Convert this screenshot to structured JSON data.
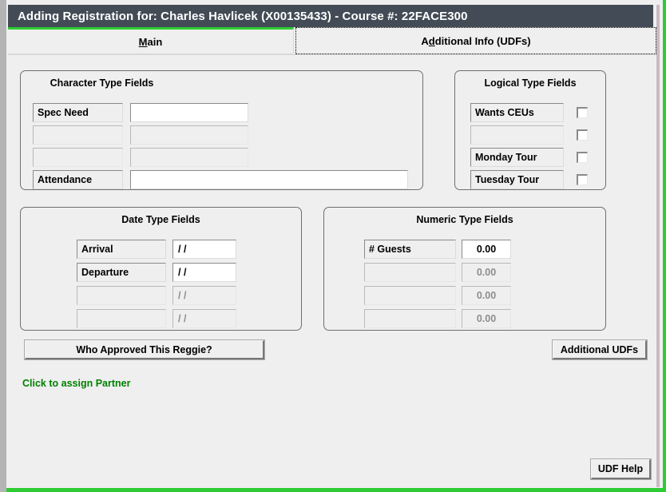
{
  "window": {
    "title": "Adding Registration for: Charles Havlicek (X00135433) - Course #: 22FACE300",
    "accent_green": "#2ecc33",
    "titlebar_color": "#434c56"
  },
  "tabs": [
    {
      "label_pre": "",
      "accel": "M",
      "label_post": "ain",
      "name": "tab-main",
      "selected": false
    },
    {
      "label_pre": "A",
      "accel": "d",
      "label_post": "ditional Info (UDFs)",
      "name": "tab-additional-info-udfs",
      "selected": true
    }
  ],
  "groups": {
    "character": {
      "title": "Character Type Fields",
      "rows": [
        {
          "label": "Spec Need",
          "value": "",
          "enabled": true
        },
        {
          "label": "",
          "value": "",
          "enabled": false
        },
        {
          "label": "",
          "value": "",
          "enabled": false
        },
        {
          "label": "Attendance",
          "value": "",
          "enabled": true
        }
      ]
    },
    "logical": {
      "title": "Logical Type Fields",
      "rows": [
        {
          "label": "Wants CEUs",
          "checked": false,
          "enabled": true
        },
        {
          "label": "",
          "checked": false,
          "enabled": false
        },
        {
          "label": "Monday Tour",
          "checked": false,
          "enabled": true
        },
        {
          "label": "Tuesday Tour",
          "checked": false,
          "enabled": true
        }
      ]
    },
    "date": {
      "title": "Date Type Fields",
      "rows": [
        {
          "label": "Arrival",
          "value": "/  /",
          "enabled": true
        },
        {
          "label": "Departure",
          "value": "/  /",
          "enabled": true
        },
        {
          "label": "",
          "value": "/  /",
          "enabled": false
        },
        {
          "label": "",
          "value": "/  /",
          "enabled": false
        }
      ]
    },
    "numeric": {
      "title": "Numeric Type Fields",
      "rows": [
        {
          "label": "# Guests",
          "value": "0.00",
          "enabled": true
        },
        {
          "label": "",
          "value": "0.00",
          "enabled": false
        },
        {
          "label": "",
          "value": "0.00",
          "enabled": false
        },
        {
          "label": "",
          "value": "0.00",
          "enabled": false
        }
      ]
    }
  },
  "buttons": {
    "who_approved": "Who Approved This Reggie?",
    "additional_udfs": "Additional UDFs",
    "udf_help": "UDF Help"
  },
  "links": {
    "assign_partner": "Click to assign Partner"
  }
}
